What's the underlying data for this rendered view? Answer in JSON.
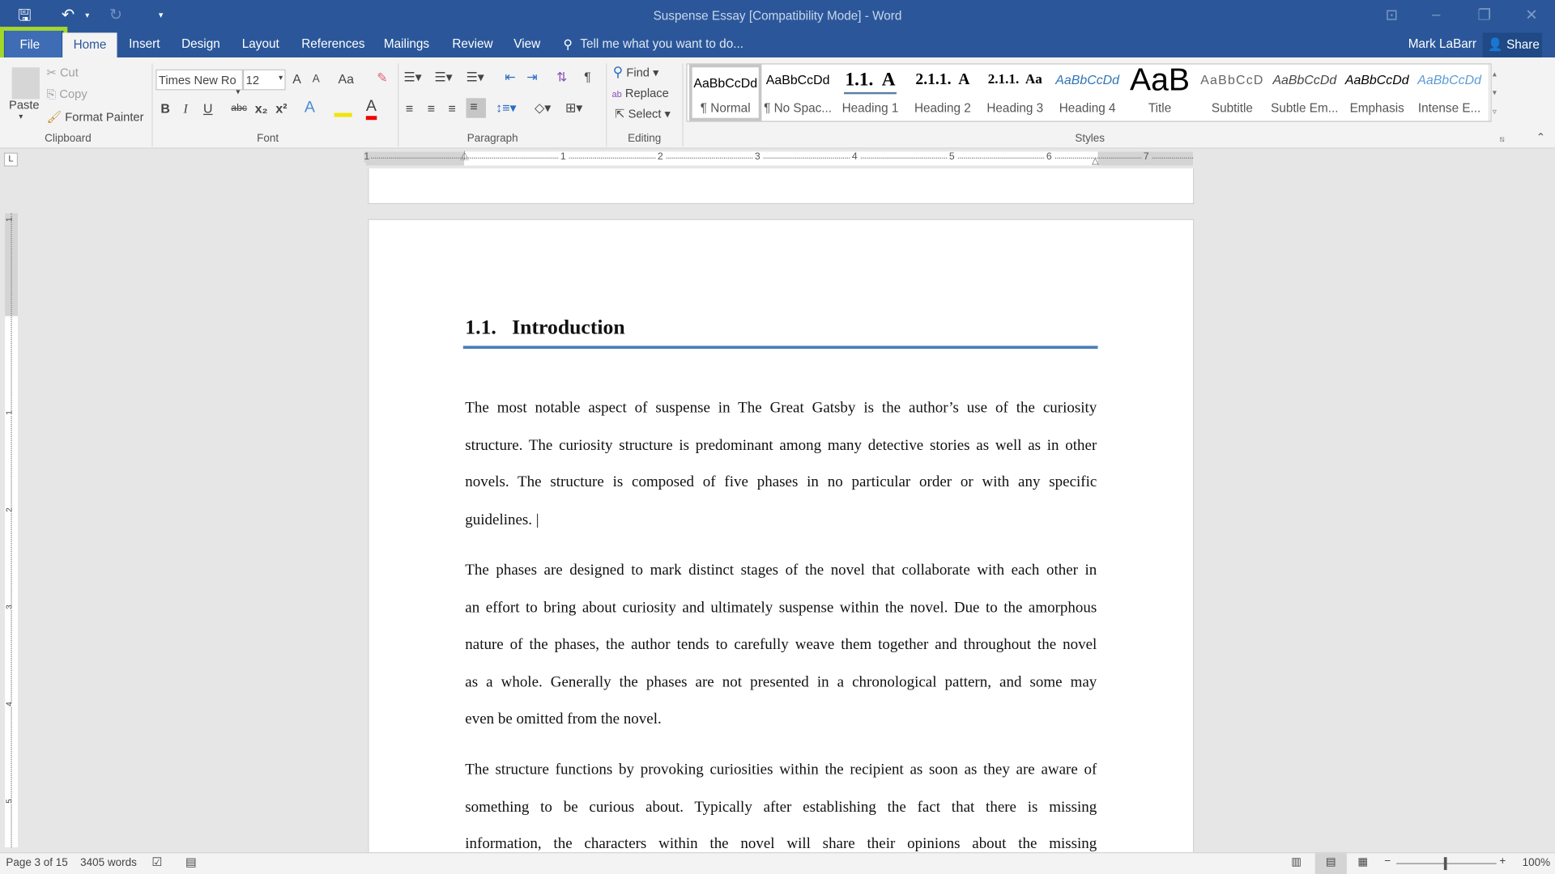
{
  "window": {
    "title": "Suspense Essay [Compatibility Mode] - Word",
    "user": "Mark LaBarr",
    "share": "Share"
  },
  "tabs": [
    "File",
    "Home",
    "Insert",
    "Design",
    "Layout",
    "References",
    "Mailings",
    "Review",
    "View"
  ],
  "tell_me": "Tell me what you want to do...",
  "clipboard": {
    "paste": "Paste",
    "cut": "Cut",
    "copy": "Copy",
    "format_painter": "Format Painter",
    "label": "Clipboard"
  },
  "font": {
    "name": "Times New Ro",
    "size": "12",
    "label": "Font",
    "grow": "A",
    "shrink": "A",
    "case": "Aa",
    "bold": "B",
    "italic": "I",
    "underline": "U",
    "strike": "abc",
    "sub": "x₂",
    "sup": "x²"
  },
  "paragraph": {
    "label": "Paragraph"
  },
  "editing": {
    "find": "Find",
    "replace": "Replace",
    "select": "Select",
    "label": "Editing"
  },
  "styles": {
    "label": "Styles",
    "items": [
      {
        "preview": "AaBbCcDd",
        "name": "¶ Normal"
      },
      {
        "preview": "AaBbCcDd",
        "name": "¶ No Spac..."
      },
      {
        "preview": "1.1.  A",
        "name": "Heading 1"
      },
      {
        "preview": "2.1.1.  A",
        "name": "Heading 2"
      },
      {
        "preview": "2.1.1.  Aa",
        "name": "Heading 3"
      },
      {
        "preview": "AaBbCcDd",
        "name": "Heading 4"
      },
      {
        "preview": "AaB",
        "name": "Title"
      },
      {
        "preview": "AaBbCcD",
        "name": "Subtitle"
      },
      {
        "preview": "AaBbCcDd",
        "name": "Subtle Em..."
      },
      {
        "preview": "AaBbCcDd",
        "name": "Emphasis"
      },
      {
        "preview": "AaBbCcDd",
        "name": "Intense E..."
      }
    ]
  },
  "ruler": [
    "1",
    "1",
    "2",
    "3",
    "4",
    "5",
    "6",
    "7"
  ],
  "vruler": [
    "1",
    "1",
    "2",
    "3",
    "4",
    "5"
  ],
  "document": {
    "heading": "1.1.   Introduction",
    "paragraphs": [
      [
        "The most notable aspect of suspense in The Great Gatsby is the author’s use of the curiosity",
        "structure. The curiosity structure is predominant among many detective stories as well as in other",
        "novels. The structure is composed of five phases in no particular order or with any specific",
        "guidelines. |"
      ],
      [
        "The phases are designed to mark distinct stages of the novel that collaborate with each other in",
        "an effort to bring about curiosity and ultimately suspense within the novel. Due to the amorphous",
        "nature of the phases, the author tends to carefully weave them together and throughout the novel",
        "as a whole. Generally the phases are not presented in a chronological pattern, and some may",
        "even be omitted from the novel."
      ],
      [
        "The structure functions by provoking curiosities within the recipient as soon as they are aware of",
        "something to be curious about. Typically after establishing the fact that there is missing",
        "information, the characters within the novel will share their opinions about the missing"
      ]
    ]
  },
  "status": {
    "page": "Page 3 of 15",
    "words": "3405 words",
    "zoom": "100%"
  },
  "colors": {
    "brand": "#2b579a",
    "highlight": "#a3d82a",
    "heading_rule": "#4a7ebb"
  }
}
